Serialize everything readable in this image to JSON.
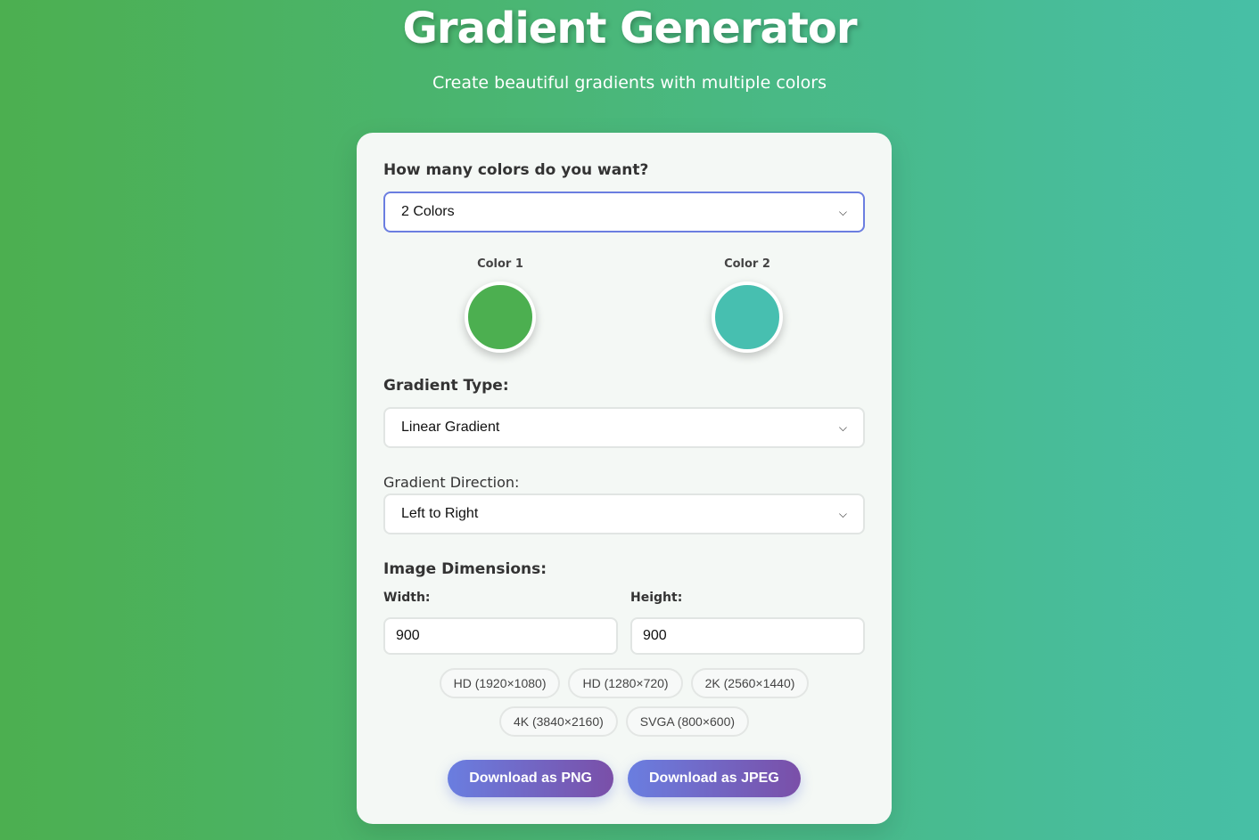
{
  "header": {
    "title": "Gradient Generator",
    "subtitle": "Create beautiful gradients with multiple colors"
  },
  "colors": {
    "question": "How many colors do you want?",
    "count_value": "2 Colors",
    "swatches": [
      {
        "label": "Color 1",
        "color": "#4caf50"
      },
      {
        "label": "Color 2",
        "color": "#47bfb0"
      }
    ]
  },
  "gradient": {
    "type_label": "Gradient Type:",
    "type_value": "Linear Gradient",
    "direction_label": "Gradient Direction:",
    "direction_value": "Left to Right"
  },
  "dimensions": {
    "label": "Image Dimensions:",
    "width_label": "Width:",
    "width_value": "900",
    "height_label": "Height:",
    "height_value": "900",
    "presets": [
      "HD (1920×1080)",
      "HD (1280×720)",
      "2K (2560×1440)",
      "4K (3840×2160)",
      "SVGA (800×600)"
    ]
  },
  "download": {
    "png_label": "Download as PNG",
    "jpeg_label": "Download as JPEG"
  },
  "theme": {
    "accent": "#6b7ee0",
    "accent_end": "#7a4fa8",
    "background_start": "#4caf50",
    "background_end": "#47bfa6"
  }
}
